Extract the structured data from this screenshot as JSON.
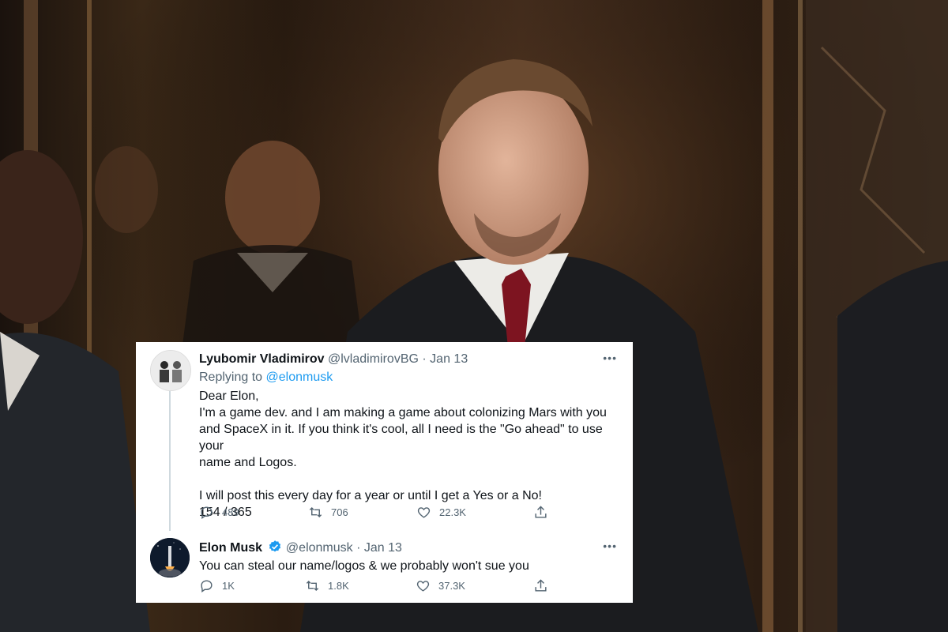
{
  "tweets": [
    {
      "name": "Lyubomir Vladimirov",
      "handle": "@lvladimirovBG",
      "date": "Jan 13",
      "more": "•••",
      "replying_prefix": "Replying to ",
      "replying_to": "@elonmusk",
      "lines": [
        "Dear Elon,",
        "I'm a game dev. and I am making a game about colonizing Mars with you",
        "and SpaceX in it. If you think it's cool, all I need is the \"Go ahead\" to use your",
        "name and Logos.",
        "",
        "I will post this every day for a year or until I get a Yes or a No!",
        "154 / 365"
      ],
      "stats": {
        "replies": "489",
        "retweets": "706",
        "likes": "22.3K"
      }
    },
    {
      "name": "Elon Musk",
      "handle": "@elonmusk",
      "date": "Jan 13",
      "more": "•••",
      "verified": true,
      "lines": [
        "You can steal our name/logos & we probably won't sue you"
      ],
      "stats": {
        "replies": "1K",
        "retweets": "1.8K",
        "likes": "37.3K"
      }
    }
  ],
  "icons": {
    "reply": "reply-icon",
    "retweet": "retweet-icon",
    "like": "heart-icon",
    "share": "share-icon",
    "verified": "verified-badge-icon"
  },
  "colors": {
    "link": "#1d9bf0",
    "secondary": "#536471",
    "text": "#0f1419",
    "card": "#ffffff"
  }
}
